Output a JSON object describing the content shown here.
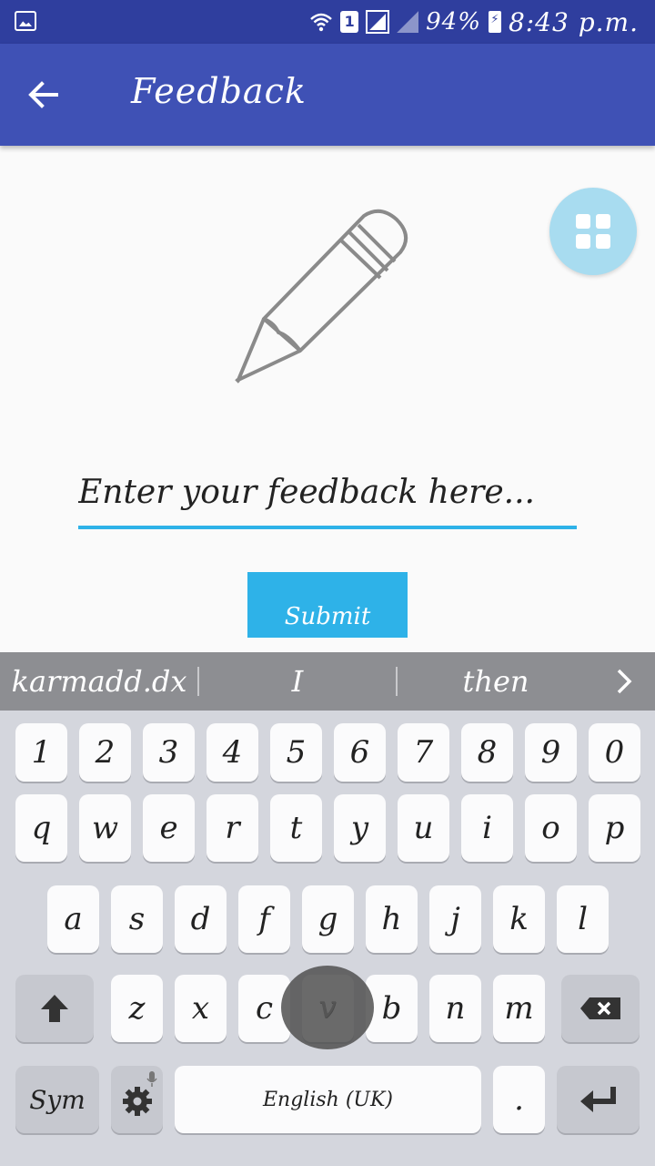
{
  "status_bar": {
    "battery": "94%",
    "time": "8:43 p.m.",
    "sim": "1",
    "icons": [
      "gallery-icon",
      "wifi-icon",
      "sim-icon",
      "no-signal-icon",
      "signal-icon",
      "battery-charging-icon"
    ]
  },
  "app_bar": {
    "title": "Feedback",
    "back_icon": "arrow-left-icon",
    "color": "#3f51b5"
  },
  "main": {
    "fab_icon": "grid-icon",
    "illustration_icon": "pencil-icon",
    "feedback_placeholder": "Enter your feedback here...",
    "submit_label": "Submit",
    "accent": "#2eb2e8"
  },
  "keyboard": {
    "suggestions": [
      "karmadd.dx",
      "I",
      "then"
    ],
    "number_row": [
      "1",
      "2",
      "3",
      "4",
      "5",
      "6",
      "7",
      "8",
      "9",
      "0"
    ],
    "row1": [
      "q",
      "w",
      "e",
      "r",
      "t",
      "y",
      "u",
      "i",
      "o",
      "p"
    ],
    "row2": [
      "a",
      "s",
      "d",
      "f",
      "g",
      "h",
      "j",
      "k",
      "l"
    ],
    "row3": [
      "z",
      "x",
      "c",
      "v",
      "b",
      "n",
      "m"
    ],
    "sym_label": "Sym",
    "space_label": "English (UK)",
    "period_label": ".",
    "pressed_key": "v"
  }
}
